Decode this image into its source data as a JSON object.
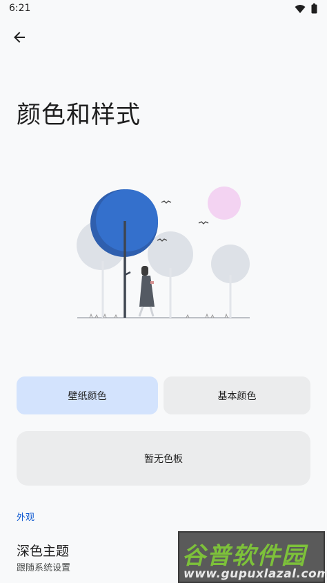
{
  "status_bar": {
    "time": "6:21"
  },
  "header": {
    "title": "颜色和样式"
  },
  "colors": {
    "accent": "#0b57d0",
    "selected_button_bg": "#d3e3fd",
    "button_bg": "#ebeced",
    "background": "#f8f9fa"
  },
  "color_source": {
    "wallpaper_label": "壁纸颜色",
    "basic_label": "基本颜色",
    "selected": "壁纸颜色"
  },
  "palette": {
    "empty_label": "暂无色板"
  },
  "appearance": {
    "section_title": "外观",
    "dark_theme_title": "深色主题",
    "dark_theme_summary": "跟随系统设置"
  },
  "watermark": {
    "title": "谷普软件园",
    "url": "www.gupuxlazal.com"
  }
}
